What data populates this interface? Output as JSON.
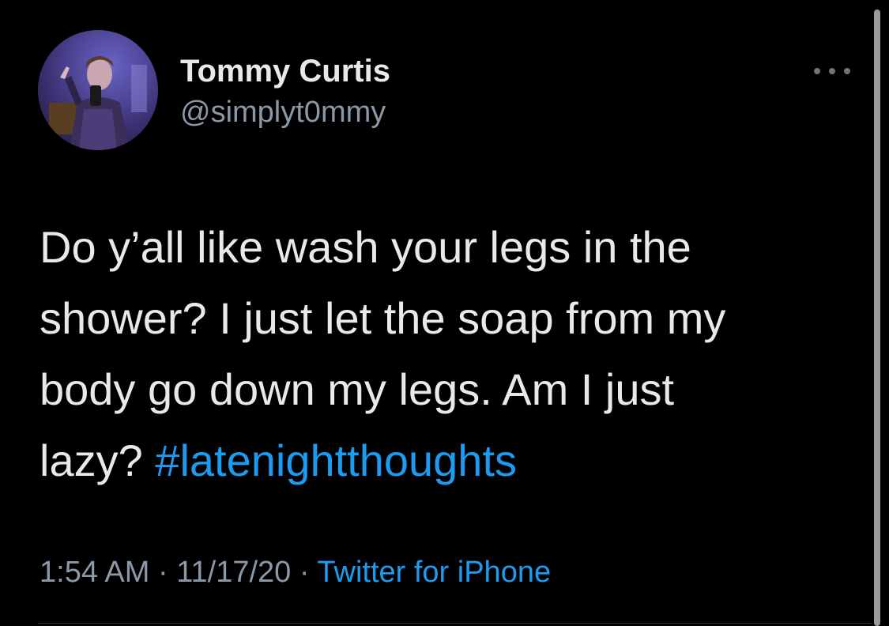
{
  "user": {
    "display_name": "Tommy Curtis",
    "handle": "@simplyt0mmy"
  },
  "tweet": {
    "text_lines": [
      "Do y’all like wash your legs in the",
      "shower? I just let the soap from my",
      "body go down my legs. Am I just",
      "lazy? "
    ],
    "hashtag": "#latenightthoughts",
    "time": "1:54 AM",
    "date": "11/17/20",
    "separator": " · ",
    "source": "Twitter for iPhone"
  },
  "icons": {
    "more": "more-options-icon"
  },
  "colors": {
    "background": "#000000",
    "text": "#e7e9ea",
    "secondary": "#8b98a5",
    "link": "#1d9bf0"
  }
}
